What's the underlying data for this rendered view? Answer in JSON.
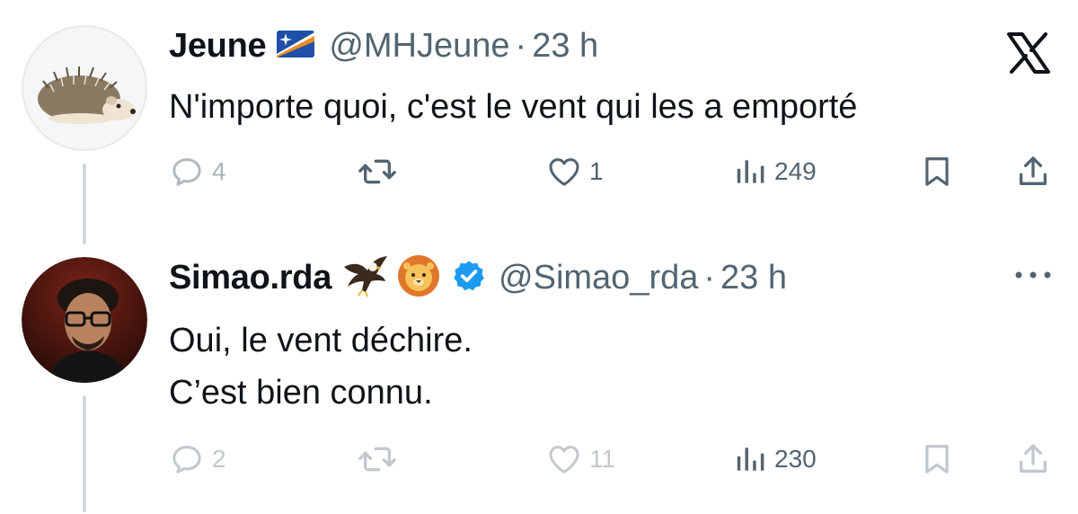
{
  "colors": {
    "text": "#0f1419",
    "muted": "#536471",
    "thread_line": "#cfd9de",
    "verified": "#1d9bf0",
    "flag_blue": "#1f4fa8",
    "flag_orange": "#f28c1b"
  },
  "tweets": [
    {
      "name": "Jeune",
      "name_emoji": "marshall-islands-flag",
      "handle": "@MHJeune",
      "separator": "·",
      "time": "23 h",
      "lines": [
        "N'importe quoi, c'est le vent qui les a emporté"
      ],
      "replies": "4",
      "retweets": "",
      "likes": "1",
      "views": "249",
      "top_right_icon": "x-logo-icon"
    },
    {
      "name": "Simao.rda",
      "name_emoji": "eagle-and-lion",
      "verified": true,
      "handle": "@Simao_rda",
      "separator": "·",
      "time": "23 h",
      "lines": [
        "Oui, le vent déchire.",
        "C’est bien connu."
      ],
      "replies": "2",
      "retweets": "",
      "likes": "11",
      "views": "230",
      "top_right_icon": "more-icon"
    }
  ]
}
